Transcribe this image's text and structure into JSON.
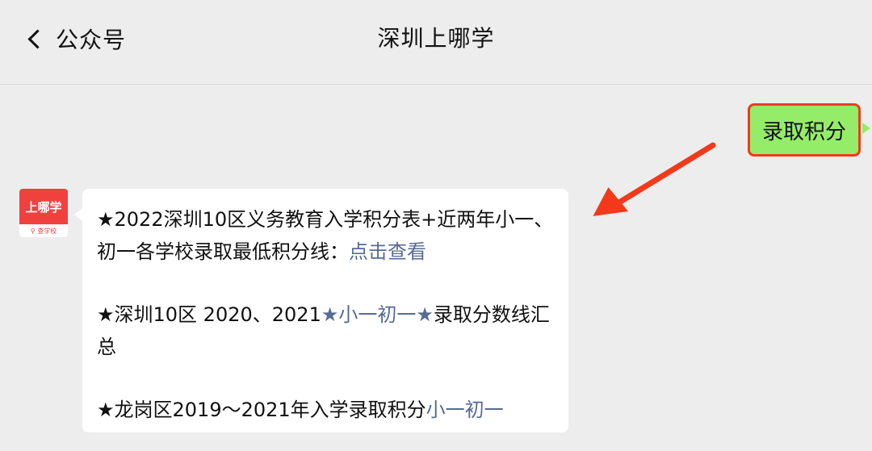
{
  "header": {
    "back_label": "公众号",
    "title": "深圳上哪学"
  },
  "sent_message": {
    "text": "录取积分"
  },
  "avatar": {
    "brand": "上哪学",
    "sub": "查学校"
  },
  "received_message": {
    "paragraphs": [
      {
        "text": "★2022深圳10区义务教育入学积分表+近两年小一、初一各学校录取最低积分线：",
        "link": "点击查看"
      },
      {
        "text": "★深圳10区 2020、2021",
        "link": "★小一初一★",
        "suffix": "录取分数线汇总"
      },
      {
        "text": "★龙岗区2019～2021年入学录取积分",
        "link": "小一初一"
      }
    ]
  },
  "colors": {
    "background": "#ededed",
    "sent_bubble": "#95ec69",
    "highlight_border": "#f23a1a",
    "link": "#576b95",
    "brand_red": "#f0413f"
  }
}
